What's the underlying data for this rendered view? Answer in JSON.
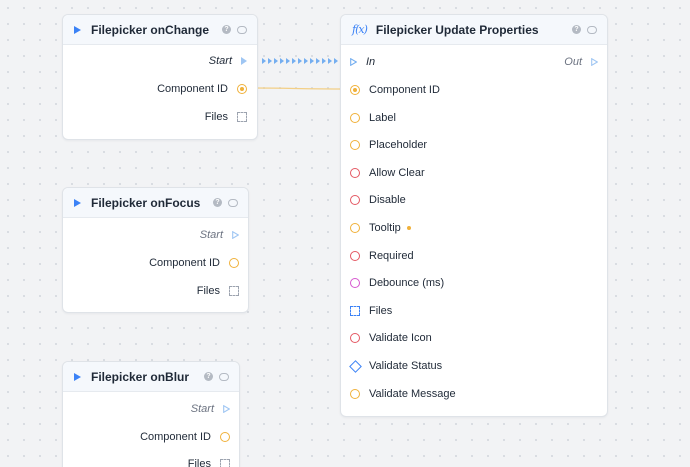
{
  "nodes": {
    "onchange": {
      "title": "Filepicker onChange",
      "start_label": "Start",
      "component_id_label": "Component ID",
      "files_label": "Files"
    },
    "onfocus": {
      "title": "Filepicker onFocus",
      "start_label": "Start",
      "component_id_label": "Component ID",
      "files_label": "Files"
    },
    "onblur": {
      "title": "Filepicker onBlur",
      "start_label": "Start",
      "component_id_label": "Component ID",
      "files_label": "Files"
    },
    "update": {
      "title": "Filepicker Update Properties",
      "in_label": "In",
      "out_label": "Out",
      "properties": [
        {
          "label": "Component ID",
          "port": "orange-filled"
        },
        {
          "label": "Label",
          "port": "orange"
        },
        {
          "label": "Placeholder",
          "port": "orange"
        },
        {
          "label": "Allow Clear",
          "port": "red"
        },
        {
          "label": "Disable",
          "port": "red"
        },
        {
          "label": "Tooltip",
          "port": "orange"
        },
        {
          "label": "Required",
          "port": "red"
        },
        {
          "label": "Debounce (ms)",
          "port": "pink"
        },
        {
          "label": "Files",
          "port": "dashed-blue"
        },
        {
          "label": "Validate Icon",
          "port": "red"
        },
        {
          "label": "Validate Status",
          "port": "diamond-blue"
        },
        {
          "label": "Validate Message",
          "port": "orange"
        }
      ]
    }
  },
  "icons": {
    "help": "question-icon",
    "comment": "comment-icon",
    "trigger": "play-icon",
    "function": "fx-icon"
  },
  "colors": {
    "accent": "#3b82f6",
    "string_port": "#f0b13a",
    "boolean_port": "#e45863",
    "number_port": "#d657cf",
    "exec_edge": "#74aef0",
    "data_edge": "#f3cf86"
  }
}
